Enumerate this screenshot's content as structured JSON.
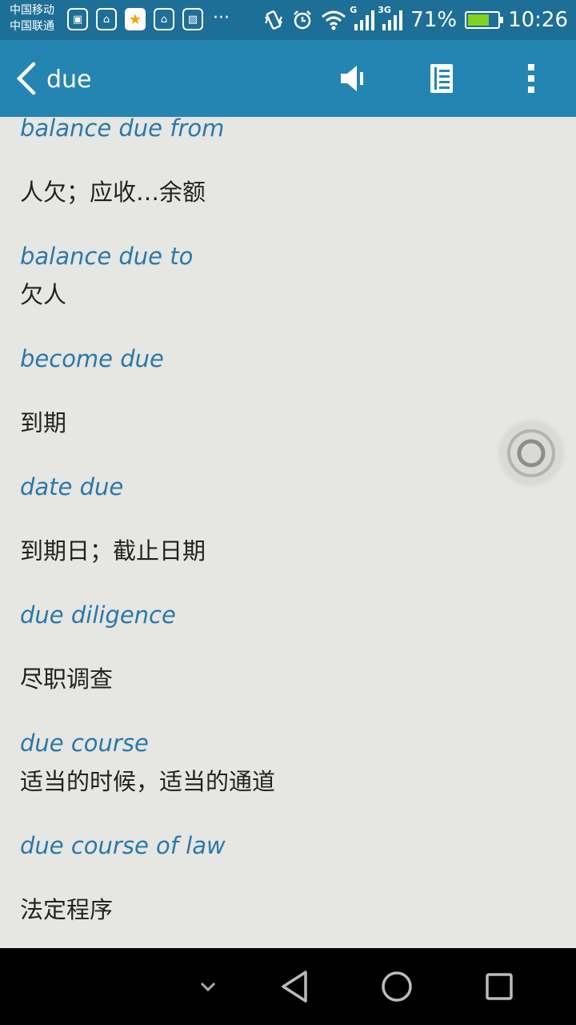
{
  "status_bar": {
    "carrier_1": "中国移动",
    "carrier_2": "中国联通",
    "network_1": "G",
    "network_2": "3G",
    "battery_percent": "71%",
    "battery_level": 0.71,
    "time": "10:26",
    "overflow": "···"
  },
  "app_bar": {
    "title": "due",
    "icons": [
      "back-arrow-icon",
      "speaker-icon",
      "list-icon",
      "more-vert-icon"
    ]
  },
  "entries": [
    {
      "term": "balance due from",
      "definition": "人欠；应收…余额"
    },
    {
      "term": "balance due to",
      "definition": "欠人"
    },
    {
      "term": "become due",
      "definition": "到期"
    },
    {
      "term": "date due",
      "definition": "到期日；截止日期"
    },
    {
      "term": "due diligence",
      "definition": "尽职调查"
    },
    {
      "term": "due course",
      "definition": "适当的时候，适当的通道"
    },
    {
      "term": "due course of law",
      "definition": "法定程序"
    }
  ],
  "colors": {
    "status_bar": "#1e6f97",
    "app_bar": "#2585b2",
    "term": "#2a79aa",
    "background": "#e6e6e3"
  }
}
